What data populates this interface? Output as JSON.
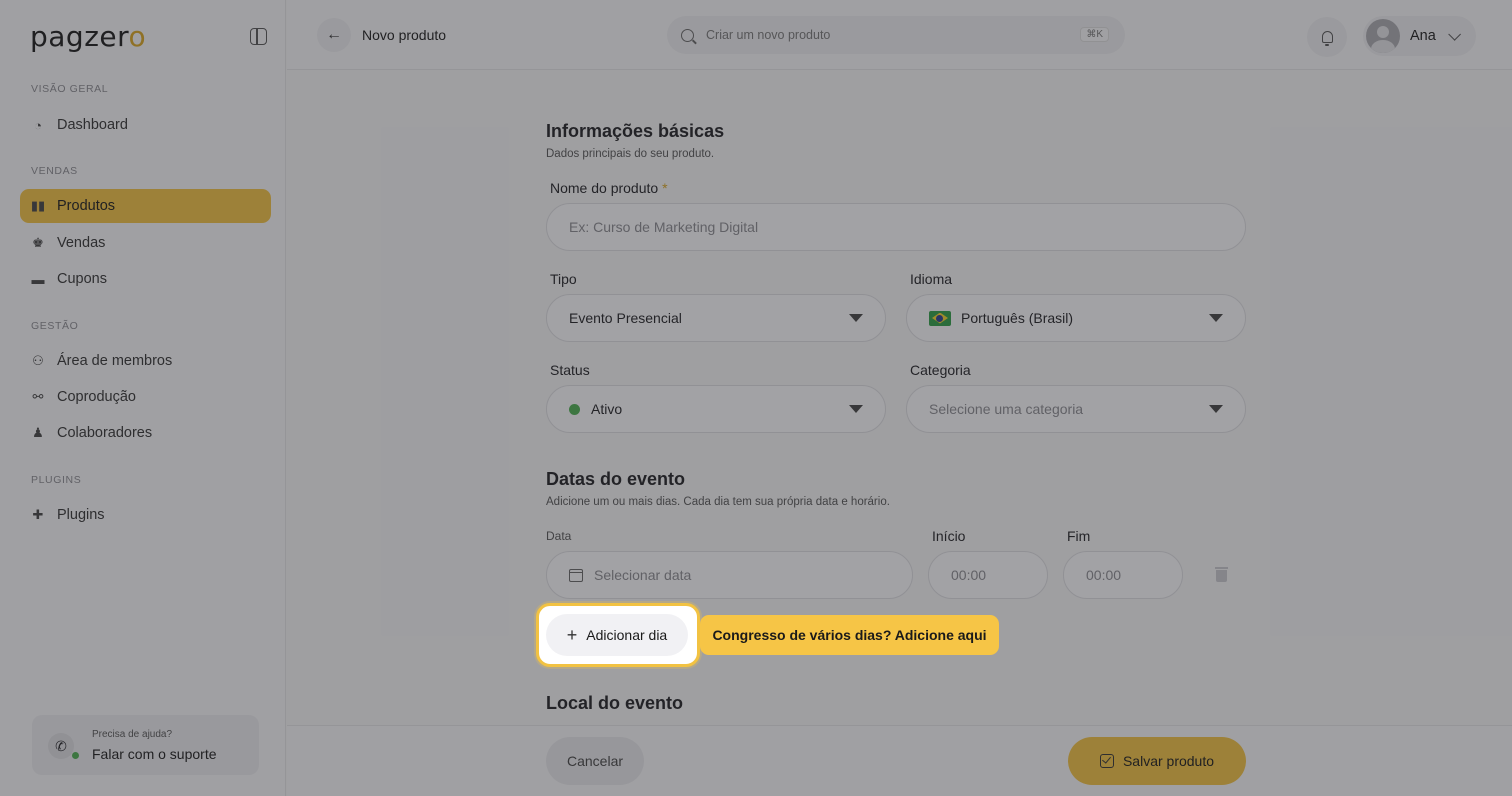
{
  "brand": {
    "logo_text_a": "pagzer",
    "logo_text_b": "o"
  },
  "sidebar": {
    "sections": [
      {
        "title": "VISÃO GERAL"
      },
      {
        "title": "VENDAS"
      },
      {
        "title": "GESTÃO"
      },
      {
        "title": "PLUGINS"
      }
    ],
    "items": [
      {
        "label": "Dashboard",
        "icon": "dashboard-icon"
      },
      {
        "label": "Produtos",
        "icon": "box-icon",
        "active": true
      },
      {
        "label": "Vendas",
        "icon": "hand-money-icon"
      },
      {
        "label": "Cupons",
        "icon": "ticket-icon"
      },
      {
        "label": "Área de membros",
        "icon": "users-icon"
      },
      {
        "label": "Coprodução",
        "icon": "handshake-icon"
      },
      {
        "label": "Colaboradores",
        "icon": "user-icon"
      },
      {
        "label": "Plugins",
        "icon": "puzzle-icon"
      }
    ],
    "help": {
      "small": "Precisa de ajuda?",
      "big": "Falar com o suporte"
    }
  },
  "topbar": {
    "title": "Novo produto",
    "search_placeholder": "Criar um novo produto",
    "shortcut": "⌘K",
    "user_name": "Ana"
  },
  "form": {
    "basic": {
      "title": "Informações básicas",
      "subtitle": "Dados principais do seu produto.",
      "name_label": "Nome do produto",
      "name_required": "*",
      "name_placeholder": "Ex: Curso de Marketing Digital",
      "tipo_label": "Tipo",
      "tipo_value": "Evento Presencial",
      "idioma_label": "Idioma",
      "idioma_value": "Português (Brasil)",
      "status_label": "Status",
      "status_value": "Ativo",
      "categoria_label": "Categoria",
      "categoria_placeholder": "Selecione uma categoria"
    },
    "dates": {
      "title": "Datas do evento",
      "subtitle": "Adicione um ou mais dias. Cada dia tem sua própria data e horário.",
      "data_label": "Data",
      "data_placeholder": "Selecionar data",
      "inicio_label": "Início",
      "inicio_placeholder": "00:00",
      "fim_label": "Fim",
      "fim_placeholder": "00:00",
      "add_day": "Adicionar dia",
      "tip": "Congresso de vários dias? Adicione aqui"
    },
    "local": {
      "title": "Local do evento"
    }
  },
  "footer": {
    "cancel": "Cancelar",
    "save": "Salvar produto"
  },
  "colors": {
    "accent": "#f2c242",
    "status_active": "#4caf50"
  }
}
